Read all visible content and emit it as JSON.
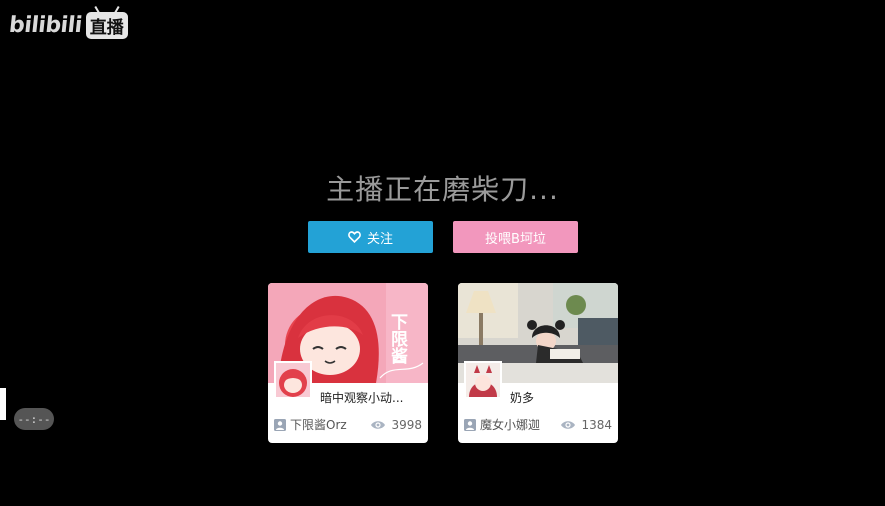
{
  "logo": {
    "text": "bilibili",
    "live_label": "直播"
  },
  "offline": {
    "message": "主播正在磨柴刀..."
  },
  "actions": {
    "follow_label": "关注",
    "tip_label": "投喂B坷垃"
  },
  "recommendations": [
    {
      "title": "暗中观察小动...",
      "uploader": "下限酱Orz",
      "views": "3998",
      "cover_text": "下限酱"
    },
    {
      "title": "奶多",
      "uploader": "魔女小娜迦",
      "views": "1384"
    }
  ],
  "player": {
    "time_display": "--:--"
  },
  "colors": {
    "follow_button": "#23a2d6",
    "tip_button": "#f297bd",
    "background": "#000000"
  }
}
